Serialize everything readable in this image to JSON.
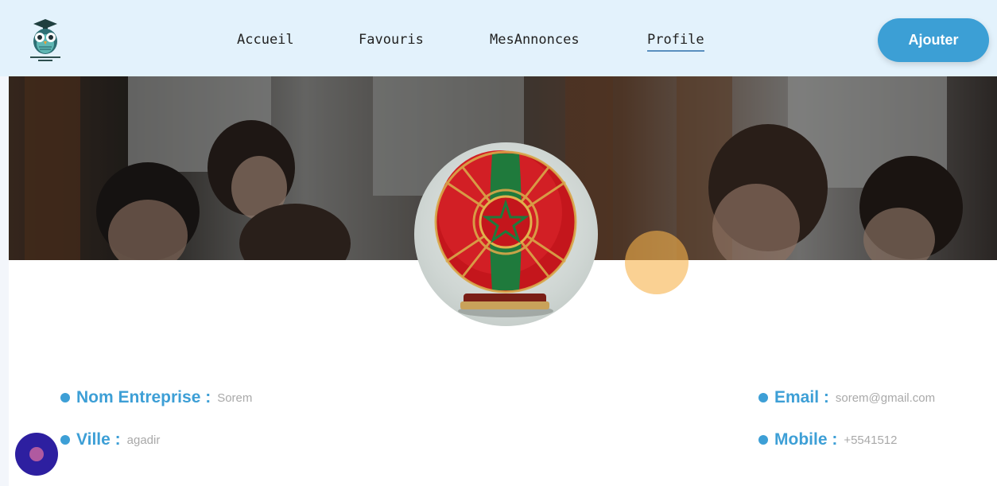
{
  "nav": {
    "items": [
      {
        "label": "Accueil"
      },
      {
        "label": "Favouris"
      },
      {
        "label": "MesAnnonces"
      },
      {
        "label": "Profile",
        "active": true
      }
    ],
    "add_button": "Ajouter",
    "logo_icon": "owl-logo-icon"
  },
  "profile": {
    "company_label": "Nom Entreprise :",
    "company_value": "Sorem",
    "city_label": "Ville :",
    "city_value": "agadir",
    "email_label": "Email :",
    "email_value": "sorem@gmail.com",
    "mobile_label": "Mobile :",
    "mobile_value": "+5541512"
  },
  "colors": {
    "accent": "#3c9fd5",
    "navbar_bg": "#e3f2fc",
    "fab": "#2d1fa0",
    "cursor": "#f7b24b"
  }
}
